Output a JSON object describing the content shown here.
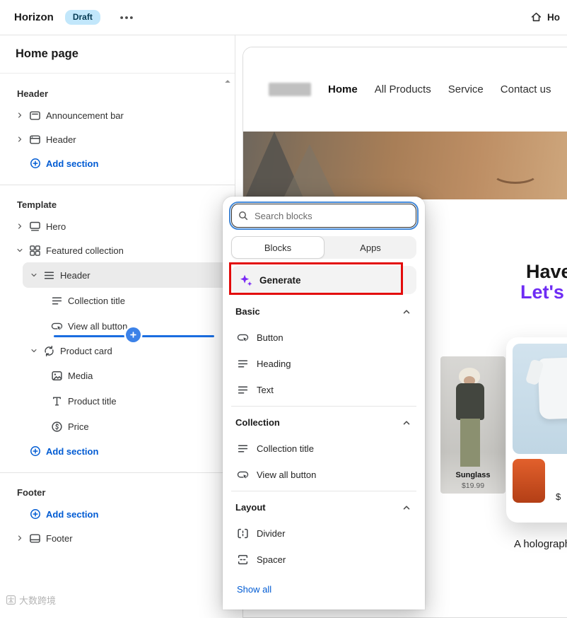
{
  "colors": {
    "accent_blue": "#005bd3",
    "selection_gray": "#ebebeb",
    "highlight_red": "#e30b0b",
    "generate_purple": "#7b2bf5",
    "badge_bg": "#c2e7fb",
    "badge_text": "#053a53",
    "hero_brown": "#a87e57",
    "brand_purple_text": "#6e2cf4"
  },
  "topbar": {
    "title": "Horizon",
    "badge": "Draft",
    "breadcrumb": "Ho"
  },
  "sidebar": {
    "title": "Home page",
    "watermark": "大数跨境",
    "header_group": {
      "label": "Header",
      "items": [
        {
          "label": "Announcement bar",
          "icon": "announcement-bar-icon"
        },
        {
          "label": "Header",
          "icon": "header-section-icon"
        }
      ],
      "add_label": "Add section"
    },
    "template_group": {
      "label": "Template",
      "hero": "Hero",
      "featured_collection": "Featured collection",
      "header_block": "Header",
      "collection_title": "Collection title",
      "view_all_button": "View all button",
      "product_card": "Product card",
      "media": "Media",
      "product_title": "Product title",
      "price": "Price",
      "add_label": "Add section"
    },
    "footer_group": {
      "label": "Footer",
      "add_label": "Add section",
      "footer_item": "Footer"
    }
  },
  "popup": {
    "search_placeholder": "Search blocks",
    "tabs": [
      {
        "label": "Blocks"
      },
      {
        "label": "Apps"
      }
    ],
    "generate_label": "Generate",
    "sections": [
      {
        "label": "Basic",
        "items": [
          {
            "label": "Button",
            "icon": "button-icon"
          },
          {
            "label": "Heading",
            "icon": "heading-icon"
          },
          {
            "label": "Text",
            "icon": "text-icon"
          }
        ]
      },
      {
        "label": "Collection",
        "items": [
          {
            "label": "Collection title",
            "icon": "collection-title-icon"
          },
          {
            "label": "View all button",
            "icon": "view-all-button-icon"
          }
        ]
      },
      {
        "label": "Layout",
        "items": [
          {
            "label": "Divider",
            "icon": "divider-icon"
          },
          {
            "label": "Spacer",
            "icon": "spacer-icon"
          }
        ]
      }
    ],
    "show_all": "Show all"
  },
  "preview": {
    "nav": [
      {
        "label": "Home"
      },
      {
        "label": "All Products"
      },
      {
        "label": "Service"
      },
      {
        "label": "Contact us"
      }
    ],
    "hero_heading_line1": "Have",
    "hero_heading_line2": "Let's br",
    "product1": {
      "name": "Sunglass",
      "price": "$19.99"
    },
    "product2": {
      "price": "$"
    },
    "caption": "A holograph"
  }
}
